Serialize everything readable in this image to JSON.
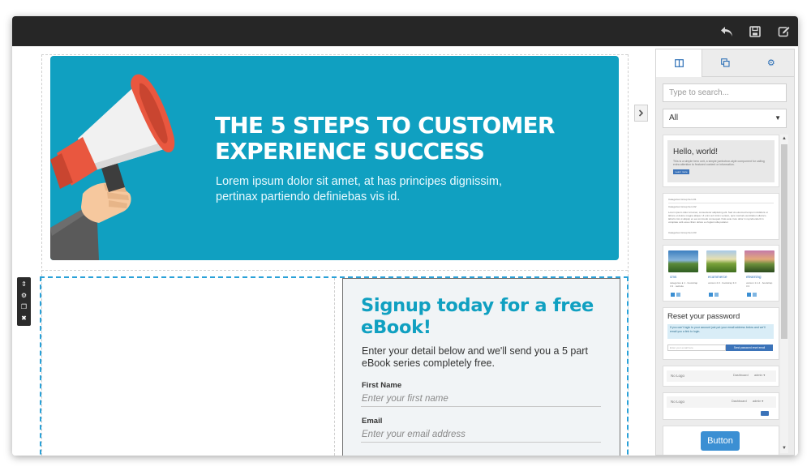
{
  "toolbar": {
    "icons": [
      "undo-icon",
      "save-icon",
      "edit-icon"
    ]
  },
  "hero": {
    "title_line1": "THE 5 STEPS TO CUSTOMER",
    "title_line2": "EXPERIENCE SUCCESS",
    "subtitle": "Lorem ipsum dolor sit amet, at has principes dignissim, pertinax partiendo definiebas vis id.",
    "background": "#10a0c1"
  },
  "signup": {
    "title": "Signup today for a free eBook!",
    "intro": "Enter your detail below and we'll send you a 5 part eBook series completely free.",
    "first_name_label": "First Name",
    "first_name_placeholder": "Enter your first name",
    "email_label": "Email",
    "email_placeholder": "Enter your email address",
    "title_color": "#10a0c1"
  },
  "panel": {
    "tabs": [
      "layout-icon",
      "copy-icon",
      "gear-icon"
    ],
    "search_placeholder": "Type to search...",
    "filter_value": "All",
    "blocks": {
      "hello": {
        "title": "Hello, world!",
        "text": "This is a simple hero unit, a simple jumbotron-style component for calling extra attention to featured content or information.",
        "button": "Learn more"
      },
      "categories": {
        "heading1": "Categories Group Item #1",
        "heading2": "Categories Group Item #2",
        "body": "Lorem ipsum dolor sit amet, consectetur adipiscing elit. Sed do eiusmod tempor incididunt ut labore et dolore magna aliqua. Ut enim ad minim veniam, quis nostrud exercitation ullamco laboris nisi ut aliquip ex ea commodo consequat. Duis aute irure dolor in reprehenderit in voluptate velit esse cillum dolore eu fugiat nulla pariatur.",
        "heading3": "Categories Group Item #3"
      },
      "products": [
        {
          "name": "cms",
          "meta": "categories ● 1 · bootstrap 3.3 · website"
        },
        {
          "name": "ecommerce",
          "meta": "version 2.0 · bootstrap 3.3"
        },
        {
          "name": "elearning",
          "meta": "version 1.1.2 · bootstrap 3.3"
        }
      ],
      "reset": {
        "title": "Reset your password",
        "info": "If you can't login to your account just put your email address below and we'll email you a link to login.",
        "input_placeholder": "Enter your email here",
        "button": "Send password reset email"
      },
      "nav1": {
        "logo": "No Logo",
        "link1": "Dashboard",
        "link2": "admin ▾"
      },
      "nav2": {
        "logo": "No Logo",
        "link1": "Dashboard",
        "link2": "admin ▾"
      },
      "button_block": {
        "label": "Button"
      }
    }
  }
}
